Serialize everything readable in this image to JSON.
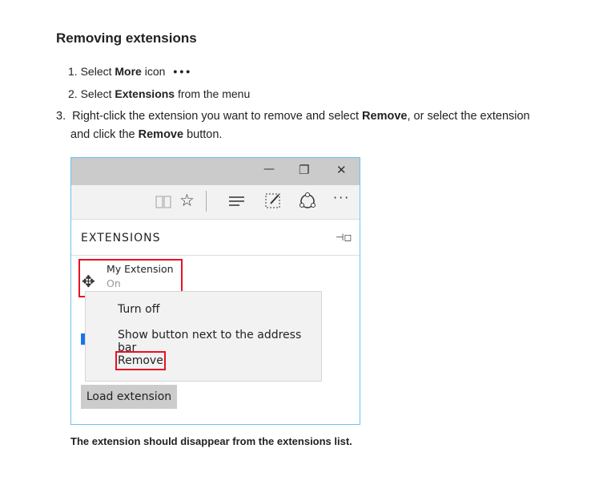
{
  "heading": "Removing extensions",
  "steps": [
    {
      "num": "1.",
      "pre": "Select ",
      "bold": "More",
      "post": " icon",
      "icon": "more-dots-icon",
      "glyph": "•••"
    },
    {
      "num": "2.",
      "pre": "Select ",
      "bold": "Extensions",
      "post": " from the menu"
    },
    {
      "num": "3.",
      "pre": "Right-click the extension you want to remove and select ",
      "bold": "Remove",
      "mid": ", or select the extension",
      "line2pre": "and click the ",
      "bold2": "Remove",
      "line2post": " button."
    }
  ],
  "screenshot": {
    "window_controls": {
      "minimize": "—",
      "restore": "❐",
      "close": "✕"
    },
    "toolbar_icons": [
      "reading-view-icon",
      "favorites-star-icon",
      "hub-icon",
      "web-note-icon",
      "share-icon",
      "more-icon"
    ],
    "panel_title": "EXTENSIONS",
    "pin_glyph": "⊣◻",
    "extension": {
      "name": "My Extension",
      "status": "On"
    },
    "context_menu": [
      "Turn off",
      "Show button next to the address bar",
      "Remove"
    ],
    "load_button": "Load extension",
    "highlight_color": "#e81123",
    "border_color": "#6cc3ee"
  },
  "caption": "The extension should disappear from the extensions list."
}
